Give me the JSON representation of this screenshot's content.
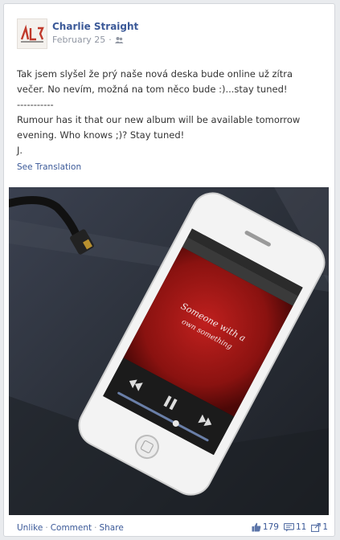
{
  "post": {
    "author": "Charlie Straight",
    "date": "February 25",
    "privacy_icon": "friends-globe-icon",
    "text_czech": "Tak jsem slyšel že prý naše nová deska bude online už zítra večer. No nevím, možná na tom něco bude :)...stay tuned!",
    "divider": "-----------",
    "text_english": "Rumour has it that our new album will be available tomorrow evening. Who knows ;)? Stay tuned!",
    "signature": "J.",
    "see_translation": "See Translation"
  },
  "photo": {
    "screen_text_line1": "Someone with a",
    "screen_text_line2": "own something"
  },
  "footer": {
    "unlike": "Unlike",
    "comment": "Comment",
    "share": "Share",
    "separator": "·",
    "likes": "179",
    "comments": "11",
    "shares": "1"
  }
}
